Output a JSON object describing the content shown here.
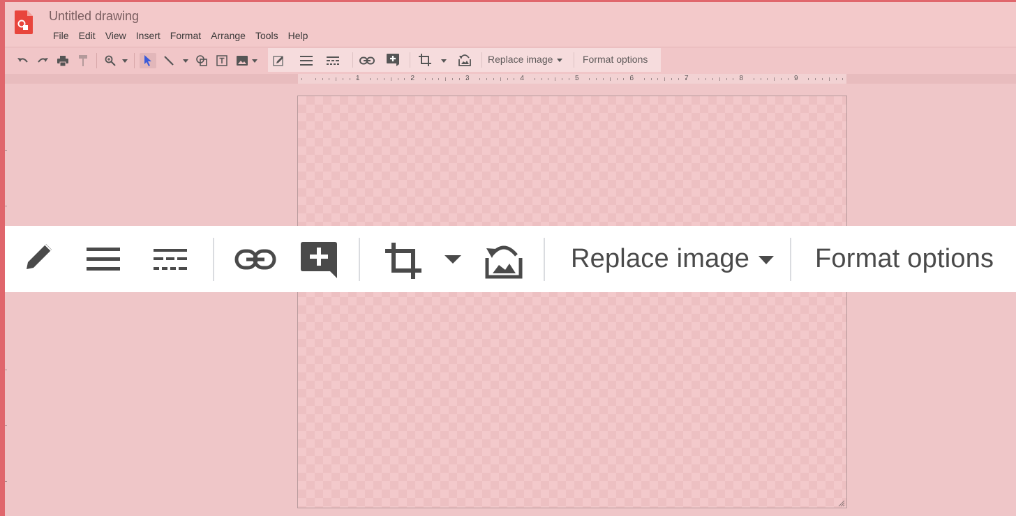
{
  "app": {
    "title": "Untitled drawing",
    "logo_icon": "google-drawings-logo",
    "brand_color": "#e8453c"
  },
  "menubar": [
    "File",
    "Edit",
    "View",
    "Insert",
    "Format",
    "Arrange",
    "Tools",
    "Help"
  ],
  "toolbar": {
    "icons": [
      "undo-icon",
      "redo-icon",
      "print-icon",
      "paint-format-icon",
      "zoom-icon",
      "select-icon",
      "line-icon",
      "shape-icon",
      "text-box-icon",
      "image-icon",
      "border-color-icon",
      "border-weight-icon",
      "border-dash-icon",
      "link-icon",
      "add-comment-icon",
      "crop-icon",
      "reset-image-icon"
    ],
    "replace_image_label": "Replace image",
    "format_options_label": "Format options"
  },
  "ruler": {
    "numbers": [
      "1",
      "2",
      "3",
      "4",
      "5",
      "6",
      "7",
      "8",
      "9"
    ]
  },
  "zoomed_toolbar": {
    "replace_image_label": "Replace image",
    "format_options_label": "Format options"
  }
}
